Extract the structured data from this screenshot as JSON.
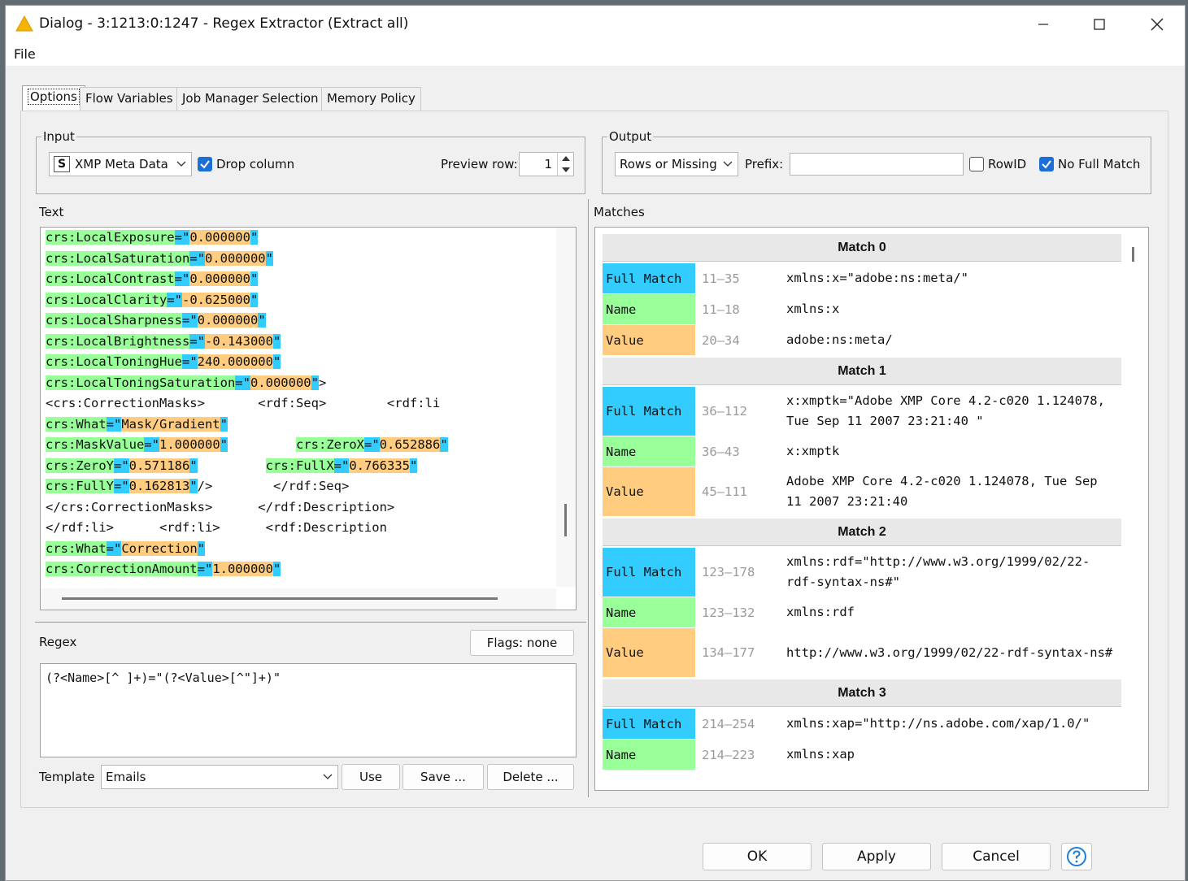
{
  "window": {
    "title": "Dialog - 3:1213:0:1247 - Regex Extractor (Extract all)"
  },
  "menu": {
    "file": "File"
  },
  "tabs": [
    {
      "label": "Options"
    },
    {
      "label": "Flow Variables"
    },
    {
      "label": "Job Manager Selection"
    },
    {
      "label": "Memory Policy"
    }
  ],
  "input": {
    "legend": "Input",
    "column_type_glyph": "S",
    "column": "XMP Meta Data",
    "drop_column_label": "Drop column",
    "preview_row_label": "Preview row:",
    "preview_row_value": "1"
  },
  "output": {
    "legend": "Output",
    "mode": "Rows or Missing",
    "prefix_label": "Prefix:",
    "prefix_value": "",
    "rowid_label": "RowID",
    "no_full_match_label": "No Full Match"
  },
  "text_section": {
    "label": "Text",
    "lines": [
      [
        {
          "t": "crs:LocalExposure",
          "c": "hn"
        },
        {
          "t": "=\"",
          "c": "hs"
        },
        {
          "t": "0.000000",
          "c": "hv"
        },
        {
          "t": "\"",
          "c": "hs"
        }
      ],
      [
        {
          "t": "crs:LocalSaturation",
          "c": "hn"
        },
        {
          "t": "=\"",
          "c": "hs"
        },
        {
          "t": "0.000000",
          "c": "hv"
        },
        {
          "t": "\"",
          "c": "hs"
        }
      ],
      [
        {
          "t": "crs:LocalContrast",
          "c": "hn"
        },
        {
          "t": "=\"",
          "c": "hs"
        },
        {
          "t": "0.000000",
          "c": "hv"
        },
        {
          "t": "\"",
          "c": "hs"
        }
      ],
      [
        {
          "t": "crs:LocalClarity",
          "c": "hn"
        },
        {
          "t": "=\"",
          "c": "hs"
        },
        {
          "t": "-0.625000",
          "c": "hv"
        },
        {
          "t": "\"",
          "c": "hs"
        }
      ],
      [
        {
          "t": "crs:LocalSharpness",
          "c": "hn"
        },
        {
          "t": "=\"",
          "c": "hs"
        },
        {
          "t": "0.000000",
          "c": "hv"
        },
        {
          "t": "\"",
          "c": "hs"
        }
      ],
      [
        {
          "t": "crs:LocalBrightness",
          "c": "hn"
        },
        {
          "t": "=\"",
          "c": "hs"
        },
        {
          "t": "-0.143000",
          "c": "hv"
        },
        {
          "t": "\"",
          "c": "hs"
        }
      ],
      [
        {
          "t": "crs:LocalToningHue",
          "c": "hn"
        },
        {
          "t": "=\"",
          "c": "hs"
        },
        {
          "t": "240.000000",
          "c": "hv"
        },
        {
          "t": "\"",
          "c": "hs"
        }
      ],
      [
        {
          "t": "crs:LocalToningSaturation",
          "c": "hn"
        },
        {
          "t": "=\"",
          "c": "hs"
        },
        {
          "t": "0.000000",
          "c": "hv"
        },
        {
          "t": "\"",
          "c": "hs"
        },
        {
          "t": ">",
          "c": ""
        }
      ],
      [
        {
          "t": "<crs:CorrectionMasks>       <rdf:Seq>        <rdf:li",
          "c": ""
        }
      ],
      [
        {
          "t": "crs:What",
          "c": "hn"
        },
        {
          "t": "=\"",
          "c": "hs"
        },
        {
          "t": "Mask/Gradient",
          "c": "hv"
        },
        {
          "t": "\"",
          "c": "hs"
        }
      ],
      [
        {
          "t": "crs:MaskValue",
          "c": "hn"
        },
        {
          "t": "=\"",
          "c": "hs"
        },
        {
          "t": "1.000000",
          "c": "hv"
        },
        {
          "t": "\"",
          "c": "hs"
        },
        {
          "t": "         ",
          "c": ""
        },
        {
          "t": "crs:ZeroX",
          "c": "hn"
        },
        {
          "t": "=\"",
          "c": "hs"
        },
        {
          "t": "0.652886",
          "c": "hv"
        },
        {
          "t": "\"",
          "c": "hs"
        }
      ],
      [
        {
          "t": "crs:ZeroY",
          "c": "hn"
        },
        {
          "t": "=\"",
          "c": "hs"
        },
        {
          "t": "0.571186",
          "c": "hv"
        },
        {
          "t": "\"",
          "c": "hs"
        },
        {
          "t": "         ",
          "c": ""
        },
        {
          "t": "crs:FullX",
          "c": "hn"
        },
        {
          "t": "=\"",
          "c": "hs"
        },
        {
          "t": "0.766335",
          "c": "hv"
        },
        {
          "t": "\"",
          "c": "hs"
        }
      ],
      [
        {
          "t": "crs:FullY",
          "c": "hn"
        },
        {
          "t": "=\"",
          "c": "hs"
        },
        {
          "t": "0.162813",
          "c": "hv"
        },
        {
          "t": "\"",
          "c": "hs"
        },
        {
          "t": "/>        </rdf:Seq>",
          "c": ""
        }
      ],
      [
        {
          "t": "</crs:CorrectionMasks>      </rdf:Description>",
          "c": ""
        }
      ],
      [
        {
          "t": "</rdf:li>      <rdf:li>      <rdf:Description",
          "c": ""
        }
      ],
      [
        {
          "t": "crs:What",
          "c": "hn"
        },
        {
          "t": "=\"",
          "c": "hs"
        },
        {
          "t": "Correction",
          "c": "hv"
        },
        {
          "t": "\"",
          "c": "hs"
        }
      ],
      [
        {
          "t": "crs:CorrectionAmount",
          "c": "hn"
        },
        {
          "t": "=\"",
          "c": "hs"
        },
        {
          "t": "1.000000",
          "c": "hv"
        },
        {
          "t": "\"",
          "c": "hs"
        }
      ]
    ]
  },
  "regex": {
    "label": "Regex",
    "flags_button": "Flags: none",
    "pattern": "(?<Name>[^ ]+)=\"(?<Value>[^\"]+)\""
  },
  "template": {
    "label": "Template",
    "selected": "Emails",
    "use": "Use",
    "save": "Save ...",
    "delete": "Delete ..."
  },
  "matches": {
    "label": "Matches",
    "items": [
      {
        "title": "Match 0",
        "rows": [
          {
            "kind": "full",
            "label": "Full Match",
            "range": "11–35",
            "value": "xmlns:x=\"adobe:ns:meta/\""
          },
          {
            "kind": "name",
            "label": "Name",
            "range": "11–18",
            "value": "xmlns:x"
          },
          {
            "kind": "value",
            "label": "Value",
            "range": "20–34",
            "value": "adobe:ns:meta/"
          }
        ]
      },
      {
        "title": "Match 1",
        "rows": [
          {
            "kind": "full",
            "label": "Full Match",
            "range": "36–112",
            "value": "x:xmptk=\"Adobe XMP Core 4.2-c020 1.124078, Tue Sep 11 2007 23:21:40 \""
          },
          {
            "kind": "name",
            "label": "Name",
            "range": "36–43",
            "value": "x:xmptk"
          },
          {
            "kind": "value",
            "label": "Value",
            "range": "45–111",
            "value": "Adobe XMP Core 4.2-c020 1.124078, Tue Sep 11 2007 23:21:40"
          }
        ]
      },
      {
        "title": "Match 2",
        "rows": [
          {
            "kind": "full",
            "label": "Full Match",
            "range": "123–178",
            "value": "xmlns:rdf=\"http://www.w3.org/1999/02/22-rdf-syntax-ns#\""
          },
          {
            "kind": "name",
            "label": "Name",
            "range": "123–132",
            "value": "xmlns:rdf"
          },
          {
            "kind": "value",
            "label": "Value",
            "range": "134–177",
            "value": "http://www.w3.org/1999/02/22-rdf-syntax-ns#"
          }
        ]
      },
      {
        "title": "Match 3",
        "rows": [
          {
            "kind": "full",
            "label": "Full Match",
            "range": "214–254",
            "value": "xmlns:xap=\"http://ns.adobe.com/xap/1.0/\""
          },
          {
            "kind": "name",
            "label": "Name",
            "range": "214–223",
            "value": "xmlns:xap"
          }
        ]
      }
    ]
  },
  "buttons": {
    "ok": "OK",
    "apply": "Apply",
    "cancel": "Cancel"
  },
  "colors": {
    "name_highlight": "#99ff99",
    "separator_highlight": "#33ccff",
    "value_highlight": "#ffcc80",
    "checkbox_accent": "#1b6fd6"
  },
  "icons": {
    "title": "warning-triangle-icon",
    "help": "help-icon"
  }
}
